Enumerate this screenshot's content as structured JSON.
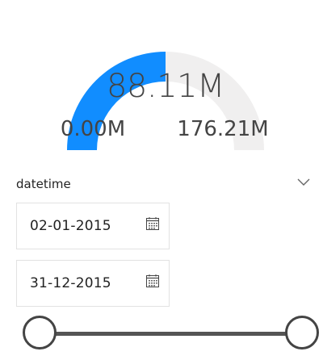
{
  "gauge": {
    "value_label": "88.11M",
    "min_label": "0.00M",
    "max_label": "176.21M",
    "value": 88.11,
    "min": 0,
    "max": 176.21,
    "fill_color": "#118DFF",
    "track_color": "#F0EFEF"
  },
  "slicer": {
    "title": "datetime",
    "start_date": "02-01-2015",
    "end_date": "31-12-2015",
    "icons": {
      "expand": "chevron-down-icon",
      "calendar": "calendar-icon"
    },
    "range_selected_fraction": [
      0,
      1
    ]
  }
}
